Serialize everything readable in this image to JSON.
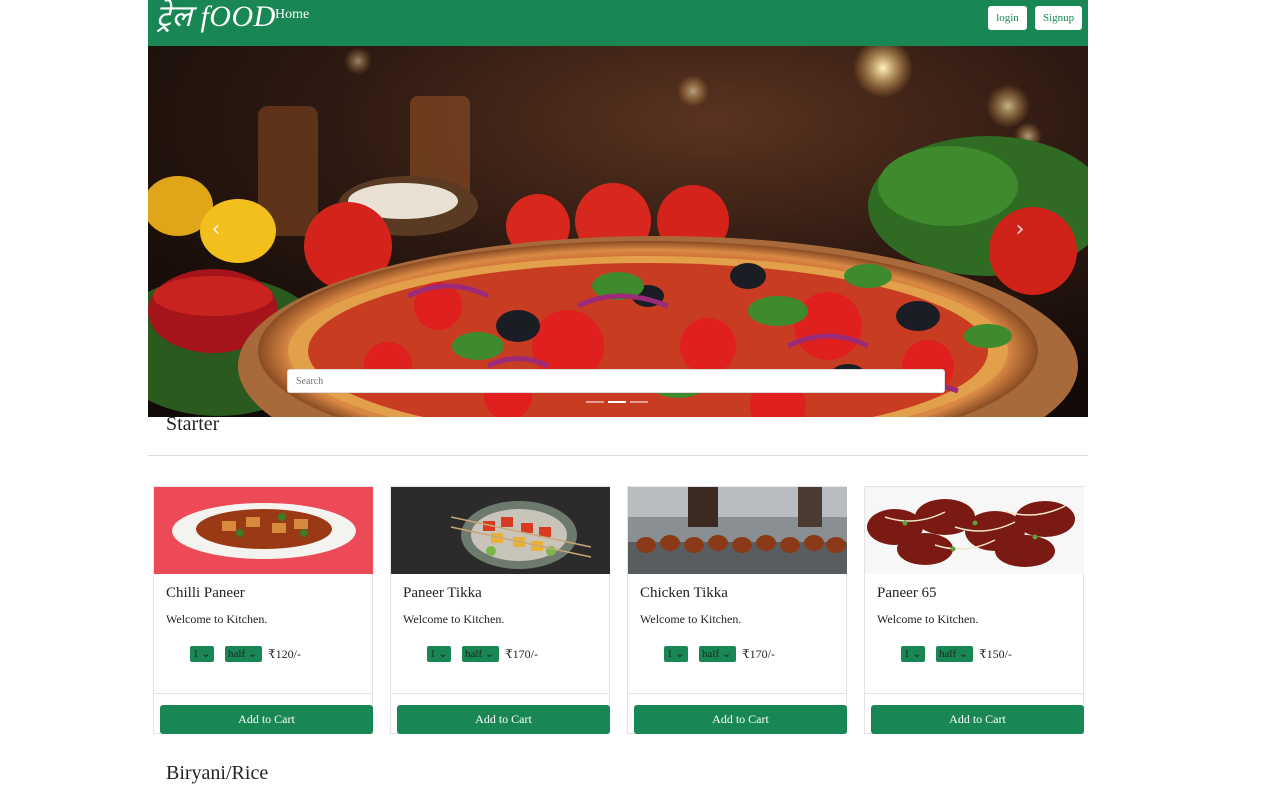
{
  "navbar": {
    "brand": "ट्रेल fOOD",
    "home_label": "Home",
    "login_label": "login",
    "signup_label": "Signup",
    "color": "#198754"
  },
  "hero": {
    "search_placeholder": "Search",
    "prev_icon": "chevron-left-icon",
    "next_icon": "chevron-right-icon",
    "slide_count": 3,
    "active_slide": 2
  },
  "sections": [
    {
      "title": "Starter",
      "cards": [
        {
          "title": "Chilli Paneer",
          "text": "Welcome to Kitchen.",
          "qty": "1",
          "size": "half",
          "price": "₹120/-",
          "button": "Add to Cart"
        },
        {
          "title": "Paneer Tikka",
          "text": "Welcome to Kitchen.",
          "qty": "1",
          "size": "half",
          "price": "₹170/-",
          "button": "Add to Cart"
        },
        {
          "title": "Chicken Tikka",
          "text": "Welcome to Kitchen.",
          "qty": "1",
          "size": "half",
          "price": "₹170/-",
          "button": "Add to Cart"
        },
        {
          "title": "Paneer 65",
          "text": "Welcome to Kitchen.",
          "qty": "1",
          "size": "half",
          "price": "₹150/-",
          "button": "Add to Cart"
        }
      ]
    },
    {
      "title": "Biryani/Rice"
    }
  ]
}
